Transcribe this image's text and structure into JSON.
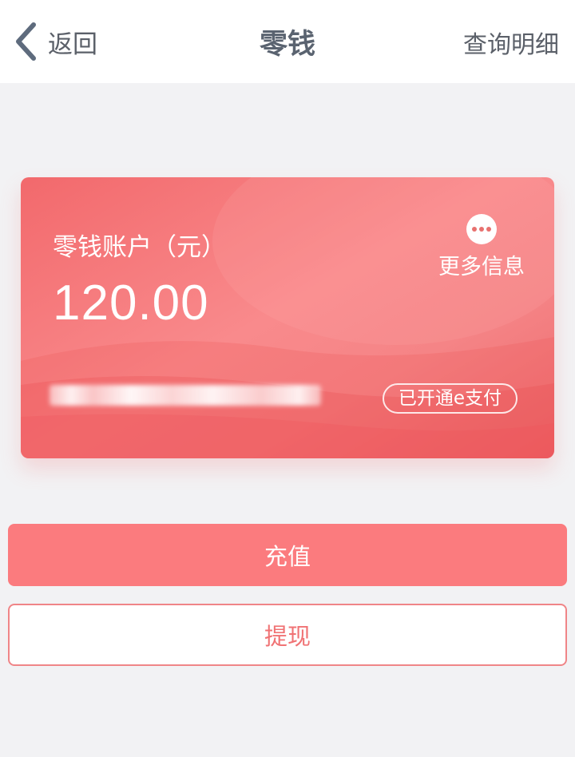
{
  "nav": {
    "back_label": "返回",
    "title": "零钱",
    "details_label": "查询明细"
  },
  "card": {
    "account_label": "零钱账户（元）",
    "balance": "120.00",
    "more_info_label": "更多信息",
    "epay_status": "已开通e支付"
  },
  "actions": {
    "recharge_label": "充值",
    "withdraw_label": "提现"
  },
  "colors": {
    "accent": "#fb7b7e",
    "card_gradient_start": "#f2696c",
    "card_gradient_mid": "#f98a8c",
    "text_dark": "#5b6069"
  },
  "icons": {
    "back": "chevron-left-icon",
    "more": "ellipsis-icon"
  }
}
